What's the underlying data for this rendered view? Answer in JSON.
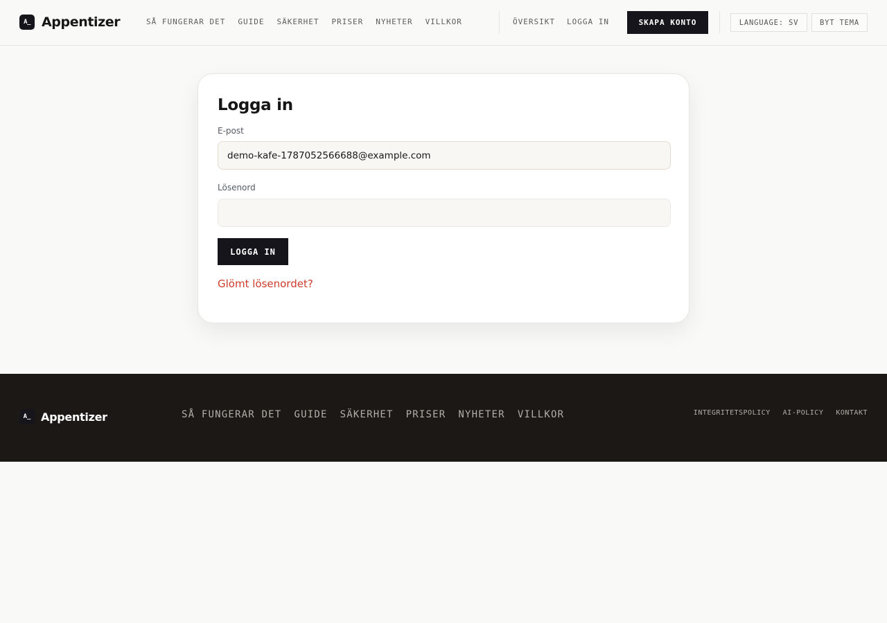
{
  "header": {
    "logo_mark": "A_",
    "brand": "Appentizer",
    "nav": [
      "SÅ FUNGERAR DET",
      "GUIDE",
      "SÄKERHET",
      "PRISER",
      "NYHETER",
      "VILLKOR"
    ],
    "auth": {
      "overview": "ÖVERSIKT",
      "login": "LOGGA IN",
      "create_account": "SKAPA KONTO"
    },
    "language": "LANGUAGE: SV",
    "theme": "BYT TEMA"
  },
  "login_form": {
    "title": "Logga in",
    "email_label": "E-post",
    "email_value": "demo-kafe-1787052566688@example.com",
    "password_label": "Lösenord",
    "password_value": "",
    "submit_label": "LOGGA IN",
    "forgot_link": "Glömt lösenordet?"
  },
  "footer": {
    "logo_mark": "A_",
    "brand": "Appentizer",
    "nav": [
      "SÅ FUNGERAR DET",
      "GUIDE",
      "SÄKERHET",
      "PRISER",
      "NYHETER",
      "VILLKOR"
    ],
    "legal": [
      "INTEGRITETSPOLICY",
      "AI-POLICY",
      "KONTAKT"
    ]
  },
  "colors": {
    "primary_dark": "#15151b",
    "link_red": "#cf3a2b",
    "footer_bg": "#1c1815",
    "page_bg": "#f9f9f7"
  }
}
